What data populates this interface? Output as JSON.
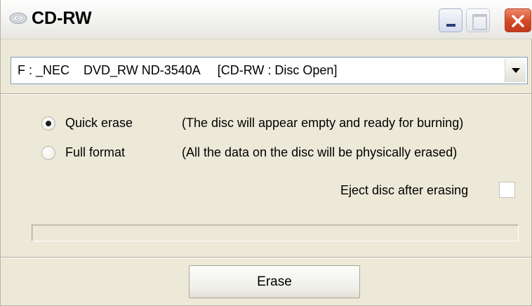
{
  "window": {
    "title": "CD-RW",
    "icon": "disc-icon",
    "controls": [
      "minimize-icon",
      "maximize-icon",
      "close-icon"
    ]
  },
  "drive": {
    "selected": "F : _NEC    DVD_RW ND-3540A     [CD-RW : Disc Open]"
  },
  "options": [
    {
      "label": "Quick erase",
      "description": "(The disc will appear empty and ready for burning)",
      "checked": true
    },
    {
      "label": "Full format",
      "description": "(All the data on the disc will be physically erased)",
      "checked": false
    }
  ],
  "eject": {
    "label": "Eject disc after erasing",
    "checked": false
  },
  "progress": {
    "value": 0
  },
  "buttons": {
    "erase": "Erase"
  },
  "colors": {
    "close_button": "#d44a26",
    "window_background": "#ece9d8",
    "field_border": "#7f9db9"
  }
}
